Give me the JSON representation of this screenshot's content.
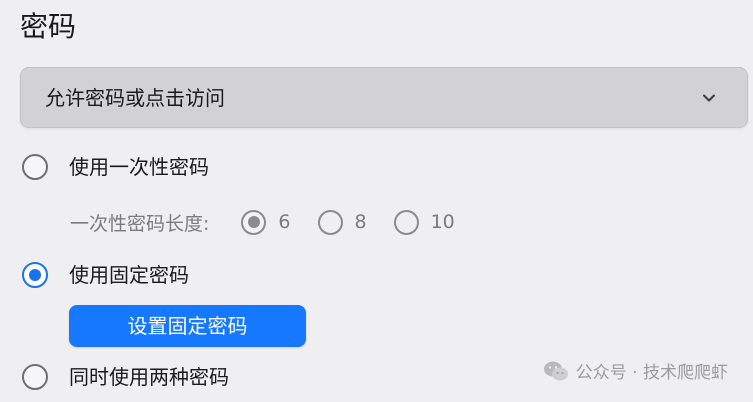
{
  "section": {
    "title": "密码"
  },
  "access_mode": {
    "selected": "允许密码或点击访问",
    "icon": "chevron-down-icon"
  },
  "password_options": [
    {
      "label": "使用一次性密码",
      "checked": false
    },
    {
      "label": "使用固定密码",
      "checked": true
    },
    {
      "label": "同时使用两种密码",
      "checked": false
    }
  ],
  "otp_length": {
    "label": "一次性密码长度:",
    "options": [
      "6",
      "8",
      "10"
    ],
    "selected": "6"
  },
  "set_fixed_password_button": "设置固定密码",
  "watermark": {
    "text": "公众号 · 技术爬爬虾",
    "icon": "wechat-icon"
  },
  "colors": {
    "accent": "#1677ff",
    "radio_selected": "#1a73e8",
    "background": "#efeff2",
    "dropdown_bg": "#d2d2d6",
    "muted_text": "#7a7a80"
  }
}
